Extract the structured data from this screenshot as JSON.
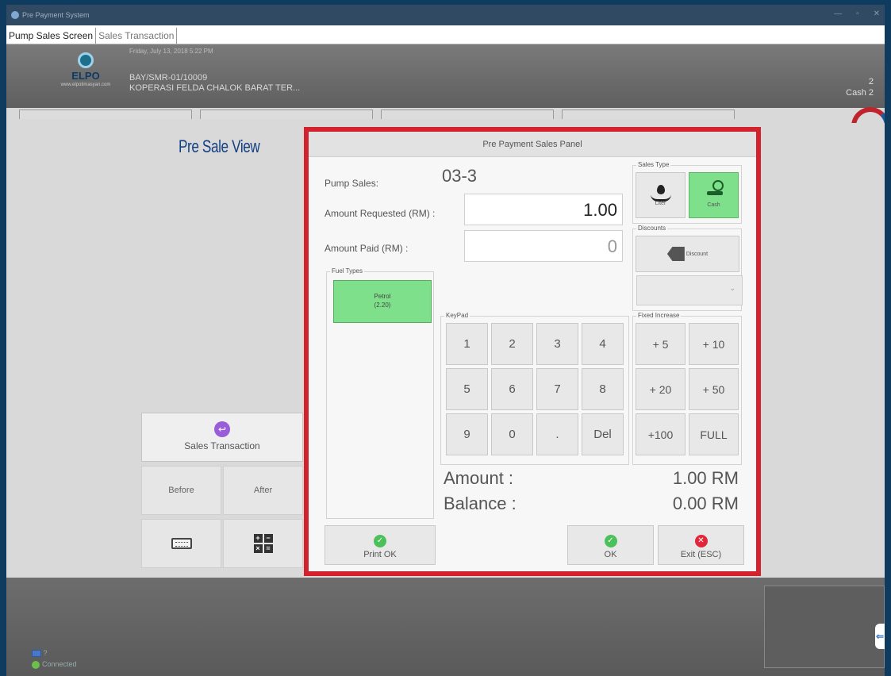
{
  "window": {
    "title": "Pre Payment System",
    "controls": [
      "—",
      "▫",
      "✕"
    ]
  },
  "tabs": [
    {
      "label": "Pump Sales Screen",
      "active": true
    },
    {
      "label": "Sales Transaction",
      "active": false
    }
  ],
  "header": {
    "logo_text": "ELPO",
    "logo_url": "www.elpotimasyan.com",
    "datetime": "Friday, July 13, 2018 5:22 PM",
    "line1": "BAY/SMR-01/10009",
    "line2": "KOPERASI FELDA CHALOK BARAT TER...",
    "right_line1": "2",
    "right_line2": "Cash 2"
  },
  "side": {
    "sales_transaction": "Sales Transaction",
    "before": "Before",
    "after": "After"
  },
  "annotation": "Pre Sale View",
  "panel": {
    "title": "Pre Payment Sales Panel",
    "pump_sales_label": "Pump Sales:",
    "pump_sales_value": "03-3",
    "amount_requested_label": "Amount Requested (RM) :",
    "amount_requested_value": "1.00",
    "amount_paid_label": "Amount Paid (RM) :",
    "amount_paid_value": "0",
    "fuel_types_title": "Fuel Types",
    "fuel_name": "Petrol",
    "fuel_price": "(2.20)",
    "sales_type_title": "Sales Type",
    "liter_label": "Liter",
    "cash_label": "Cash",
    "discounts_title": "Discounts",
    "discount_label": "Discount",
    "keypad_title": "KeyPad",
    "keypad": [
      "1",
      "2",
      "3",
      "4",
      "5",
      "6",
      "7",
      "8",
      "9",
      "0",
      ".",
      "Del"
    ],
    "fixed_title": "Fixed Increase",
    "fixed": [
      "+ 5",
      "+ 10",
      "+ 20",
      "+ 50",
      "+100",
      "FULL"
    ],
    "amount_label": "Amount :",
    "amount_value": "1.00 RM",
    "balance_label": "Balance :",
    "balance_value": "0.00 RM",
    "print_ok": "Print OK",
    "ok": "OK",
    "exit": "Exit (ESC)"
  },
  "status": {
    "monitor_count": "?",
    "connection": "Connected"
  },
  "colors": {
    "highlight_border": "#d2222d",
    "active_green": "#7ee08a",
    "annotation_blue": "#143f80"
  }
}
